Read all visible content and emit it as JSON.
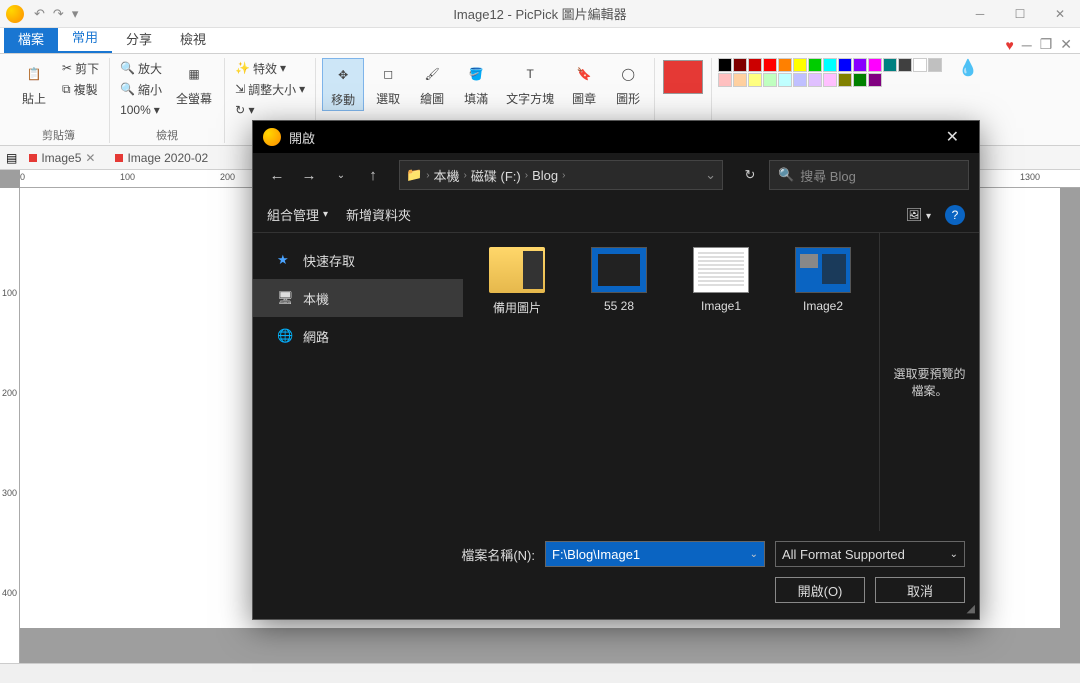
{
  "window": {
    "title": "Image12 - PicPick 圖片編輯器"
  },
  "ribbontabs": {
    "file": "檔案",
    "home": "常用",
    "share": "分享",
    "view": "檢視"
  },
  "ribbon": {
    "clipboard": {
      "paste": "貼上",
      "cut": "剪下",
      "copy": "複製",
      "label": "剪貼簿"
    },
    "view": {
      "zoomin": "放大",
      "zoomout": "縮小",
      "zoom": "100%",
      "fullscreen": "全螢幕",
      "label": "檢視"
    },
    "image": {
      "effects": "特效",
      "resize": "調整大小",
      "rotate_icon": "旋轉"
    },
    "tools": {
      "move": "移動",
      "select": "選取",
      "draw": "繪圖",
      "fill": "填滿",
      "text": "文字方塊",
      "stamp": "圖章",
      "shape": "圖形"
    }
  },
  "doctabs": {
    "t1": "Image5",
    "t2": "Image 2020-02"
  },
  "ruler": {
    "h0": "0",
    "h100": "100",
    "h200": "200",
    "h1300": "1300",
    "v100": "100",
    "v200": "200",
    "v300": "300",
    "v400": "400"
  },
  "dialog": {
    "title": "開啟",
    "breadcrumb": {
      "thispc": "本機",
      "disk": "磁碟 (F:)",
      "folder": "Blog"
    },
    "search_placeholder": "搜尋 Blog",
    "toolbar": {
      "organize": "組合管理",
      "newfolder": "新增資料夾"
    },
    "sidebar": {
      "quick": "快速存取",
      "thispc": "本機",
      "network": "網路"
    },
    "files": {
      "f1": "備用圖片",
      "f2": "55 28",
      "f3": "Image1",
      "f4": "Image2"
    },
    "preview_hint": "選取要預覽的檔案。",
    "fname_label": "檔案名稱(N):",
    "fname_value": "F:\\Blog\\Image1",
    "filter": "All Format Supported",
    "open_btn": "開啟(O)",
    "cancel_btn": "取消"
  }
}
